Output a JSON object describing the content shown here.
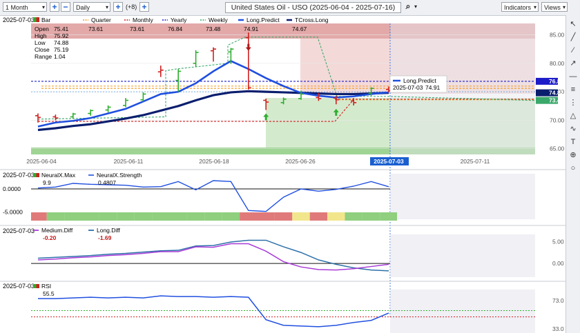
{
  "toolbar": {
    "period": "1 Month",
    "interval": "Daily",
    "indicator_count": "(+8)",
    "title": "United States Oil - USO (2025-06-04 - 2025-07-16)",
    "indicators_label": "Indicators",
    "views_label": "Views"
  },
  "main": {
    "date": "2025-07-03",
    "legend": [
      {
        "name": "Bar",
        "color": "#d11f1f"
      },
      {
        "name": "Quarter",
        "color": "#f39a1e"
      },
      {
        "name": "Monthly",
        "color": "#d11f1f"
      },
      {
        "name": "Yearly",
        "color": "#1c1cc8"
      },
      {
        "name": "Weekly",
        "color": "#3aa86a"
      },
      {
        "name": "Long.Predict",
        "color": "#1f4fe0"
      },
      {
        "name": "TCross.Long",
        "color": "#0a1e6e"
      }
    ],
    "ohlc_labels": [
      "Open",
      "High",
      "Low",
      "Close",
      "Range"
    ],
    "ohlc_values": [
      "75.41",
      "75.92",
      "74.88",
      "75.19",
      "1.04"
    ],
    "level_values": [
      "73.61",
      "73.61",
      "76.84",
      "73.48",
      "74.91",
      "74.67"
    ],
    "price_ticks": [
      "85.00",
      "80.00",
      "75.00",
      "70.00",
      "65.00"
    ],
    "badges": [
      {
        "value": "76.84",
        "color": "#1c1cc8"
      },
      {
        "value": "74.82",
        "color": "#0a1e6e"
      },
      {
        "value": "73.48",
        "color": "#3aa86a"
      }
    ],
    "date_ticks": [
      "2025-06-04",
      "2025-06-11",
      "2025-06-18",
      "2025-06-26",
      "2025-07-03",
      "2025-07-11"
    ],
    "crosshair_date": "2025-07-03",
    "tooltip": {
      "title": "Long.Predict",
      "date": "2025-07-03",
      "value": "74.91"
    }
  },
  "panels": {
    "neural": {
      "date": "2025-07-03",
      "legend": [
        {
          "name": "NeuralX.Max",
          "value": "9.9"
        },
        {
          "name": "NeuralX.Strength",
          "value": "0.4807"
        }
      ],
      "ticks": [
        "0.0000",
        "-5.0000"
      ]
    },
    "diff": {
      "date": "2025-07-03",
      "legend": [
        {
          "name": "Medium.Diff",
          "value": "-0.20",
          "color": "#a83ad8"
        },
        {
          "name": "Long.Diff",
          "value": "-1.69",
          "color": "#2c6fa8"
        }
      ],
      "ticks": [
        "5.00",
        "0.00"
      ]
    },
    "rsi": {
      "date": "2025-07-03",
      "legend": [
        {
          "name": "RSI",
          "value": "55.5"
        }
      ],
      "ticks": [
        "73.0",
        "33.0"
      ]
    }
  },
  "right_tools": [
    "pointer-icon",
    "line-icon",
    "ray-icon",
    "arrow-icon",
    "hline-icon",
    "channel-icon",
    "fib-icon",
    "triangle-icon",
    "curve-icon",
    "text-icon",
    "zoom-icon",
    "circle-icon"
  ],
  "chart_data": {
    "type": "candlestick",
    "dates": [
      "2025-06-04",
      "2025-06-05",
      "2025-06-06",
      "2025-06-09",
      "2025-06-10",
      "2025-06-11",
      "2025-06-12",
      "2025-06-13",
      "2025-06-16",
      "2025-06-17",
      "2025-06-18",
      "2025-06-20",
      "2025-06-23",
      "2025-06-24",
      "2025-06-25",
      "2025-06-26",
      "2025-06-27",
      "2025-06-30",
      "2025-07-01",
      "2025-07-02",
      "2025-07-03"
    ],
    "bars": [
      {
        "o": 70.8,
        "h": 71.2,
        "l": 69.6,
        "c": 70.5,
        "up": false
      },
      {
        "o": 70.6,
        "h": 71.0,
        "l": 70.0,
        "c": 70.4,
        "up": false
      },
      {
        "o": 70.6,
        "h": 71.3,
        "l": 70.3,
        "c": 71.1,
        "up": true
      },
      {
        "o": 71.2,
        "h": 71.9,
        "l": 70.8,
        "c": 71.7,
        "up": true
      },
      {
        "o": 71.8,
        "h": 72.6,
        "l": 71.4,
        "c": 72.3,
        "up": true
      },
      {
        "o": 72.6,
        "h": 73.9,
        "l": 72.3,
        "c": 73.5,
        "up": true
      },
      {
        "o": 73.6,
        "h": 74.9,
        "l": 73.3,
        "c": 74.6,
        "up": true
      },
      {
        "o": 78.5,
        "h": 79.6,
        "l": 77.6,
        "c": 78.8,
        "up": false
      },
      {
        "o": 77.0,
        "h": 79.0,
        "l": 75.0,
        "c": 78.6,
        "up": true
      },
      {
        "o": 80.0,
        "h": 82.3,
        "l": 79.4,
        "c": 81.9,
        "up": true
      },
      {
        "o": 82.2,
        "h": 82.8,
        "l": 80.3,
        "c": 82.5,
        "up": false
      },
      {
        "o": 82.0,
        "h": 82.7,
        "l": 79.9,
        "c": 82.5,
        "up": true
      },
      {
        "o": 84.5,
        "h": 85.4,
        "l": 75.4,
        "c": 75.7,
        "up": false
      },
      {
        "o": 73.5,
        "h": 73.8,
        "l": 71.8,
        "c": 73.2,
        "up": false
      },
      {
        "o": 73.1,
        "h": 74.0,
        "l": 72.8,
        "c": 73.7,
        "up": true
      },
      {
        "o": 73.8,
        "h": 75.2,
        "l": 73.6,
        "c": 74.6,
        "up": true
      },
      {
        "o": 74.0,
        "h": 74.8,
        "l": 73.4,
        "c": 73.8,
        "up": false
      },
      {
        "o": 73.9,
        "h": 74.3,
        "l": 72.8,
        "c": 73.6,
        "up": false
      },
      {
        "o": 73.4,
        "h": 73.9,
        "l": 72.6,
        "c": 73.1,
        "up": false
      },
      {
        "o": 74.7,
        "h": 75.8,
        "l": 74.3,
        "c": 75.6,
        "up": true
      },
      {
        "o": 75.41,
        "h": 75.92,
        "l": 74.88,
        "c": 75.19,
        "up": false
      }
    ],
    "levels": {
      "Quarter": 73.61,
      "Monthly": 73.61,
      "Yearly": 76.84,
      "Weekly": 73.48
    },
    "long_predict": [
      68.9,
      69.6,
      69.9,
      70.4,
      71.2,
      72.0,
      73.3,
      74.6,
      75.0,
      76.5,
      78.6,
      80.4,
      79.0,
      77.4,
      76.0,
      74.8,
      74.3,
      74.0,
      74.2,
      74.6,
      74.91
    ],
    "tcross_long": [
      68.3,
      68.6,
      69.0,
      69.3,
      69.8,
      70.3,
      70.9,
      71.7,
      72.5,
      73.5,
      74.4,
      74.9,
      75.1,
      75.0,
      74.9,
      74.8,
      74.7,
      74.6,
      74.6,
      74.7,
      74.82
    ],
    "neural_strength": [
      0.2,
      0.4,
      1.2,
      1.0,
      0.9,
      0.8,
      0.4,
      0.5,
      1.6,
      -0.2,
      1.8,
      1.6,
      -4.7,
      -4.9,
      -1.8,
      0.0,
      -0.5,
      -0.1,
      0.6,
      1.6,
      0.48
    ],
    "medium_diff": [
      0.8,
      1.0,
      1.3,
      1.5,
      1.8,
      2.0,
      2.3,
      2.7,
      2.7,
      3.8,
      3.7,
      4.5,
      4.5,
      2.8,
      0.4,
      -0.8,
      -1.4,
      -1.5,
      -1.2,
      -0.7,
      -0.2
    ],
    "long_diff": [
      1.2,
      1.4,
      1.6,
      1.8,
      2.1,
      2.3,
      2.6,
      2.9,
      3.0,
      4.0,
      4.1,
      4.9,
      5.3,
      5.3,
      3.8,
      2.5,
      0.8,
      -0.2,
      -1.0,
      -1.5,
      -1.69
    ],
    "rsi": [
      76,
      76,
      77,
      78,
      77,
      78,
      77,
      80,
      79,
      79,
      78,
      79,
      78,
      46,
      38,
      37,
      36,
      38,
      42,
      45,
      55.5
    ],
    "y_range": [
      64,
      87
    ]
  }
}
